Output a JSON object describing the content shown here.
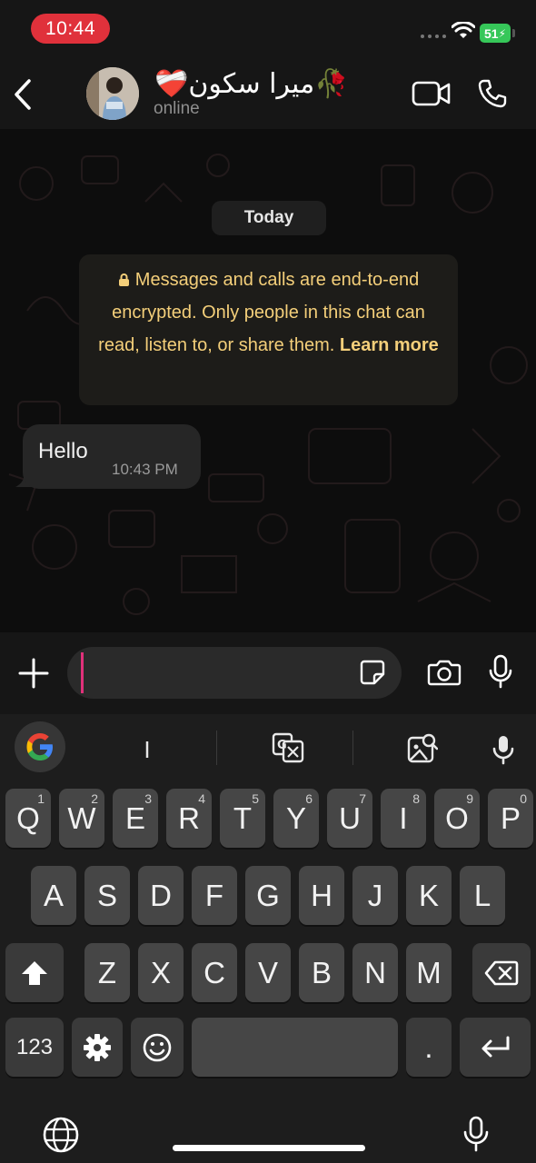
{
  "status_bar": {
    "time": "10:44",
    "battery": "51"
  },
  "header": {
    "contact_name": "❤️‍🩹میرا سکون🥀",
    "contact_status": "online"
  },
  "chat": {
    "date_chip": "Today",
    "encryption_notice": "Messages and calls are end-to-end encrypted. Only people in this chat can read, listen to, or share them.",
    "learn_more": "Learn more",
    "messages": [
      {
        "text": "Hello",
        "time": "10:43 PM",
        "direction": "incoming"
      }
    ]
  },
  "input": {
    "value": ""
  },
  "keyboard": {
    "suggestion": "I",
    "row1": [
      {
        "key": "Q",
        "hint": "1"
      },
      {
        "key": "W",
        "hint": "2"
      },
      {
        "key": "E",
        "hint": "3"
      },
      {
        "key": "R",
        "hint": "4"
      },
      {
        "key": "T",
        "hint": "5"
      },
      {
        "key": "Y",
        "hint": "6"
      },
      {
        "key": "U",
        "hint": "7"
      },
      {
        "key": "I",
        "hint": "8"
      },
      {
        "key": "O",
        "hint": "9"
      },
      {
        "key": "P",
        "hint": "0"
      }
    ],
    "row2": [
      "A",
      "S",
      "D",
      "F",
      "G",
      "H",
      "J",
      "K",
      "L"
    ],
    "row3": [
      "Z",
      "X",
      "C",
      "V",
      "B",
      "N",
      "M"
    ],
    "numbers_key": "123",
    "period_key": "."
  },
  "colors": {
    "time_pill": "#e0313b",
    "battery": "#36c759",
    "encryption_text": "#f4cf7a",
    "caret": "#e0317a"
  },
  "icons": [
    "back-icon",
    "video-call-icon",
    "voice-call-icon",
    "lock-icon",
    "plus-icon",
    "sticker-icon",
    "camera-icon",
    "mic-icon",
    "google-icon",
    "translate-icon",
    "lens-icon",
    "shift-icon",
    "backspace-icon",
    "gear-icon",
    "emoji-icon",
    "return-icon",
    "globe-icon"
  ]
}
